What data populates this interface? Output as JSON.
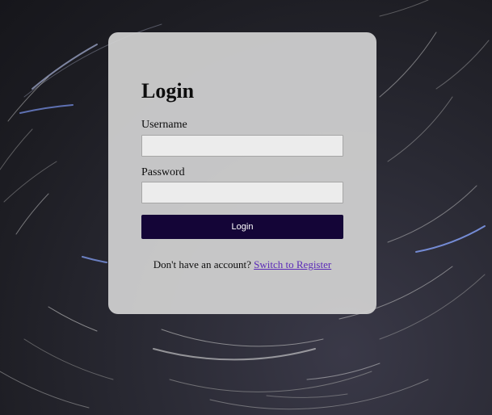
{
  "form": {
    "title": "Login",
    "username_label": "Username",
    "username_value": "",
    "password_label": "Password",
    "password_value": "",
    "submit_label": "Login",
    "switch_prompt": "Don't have an account?",
    "switch_link": "Switch to Register"
  },
  "colors": {
    "button_bg": "#140537",
    "link": "#5b2ab8",
    "card_bg": "#d2d2d2",
    "page_bg": "#1d1d23"
  }
}
